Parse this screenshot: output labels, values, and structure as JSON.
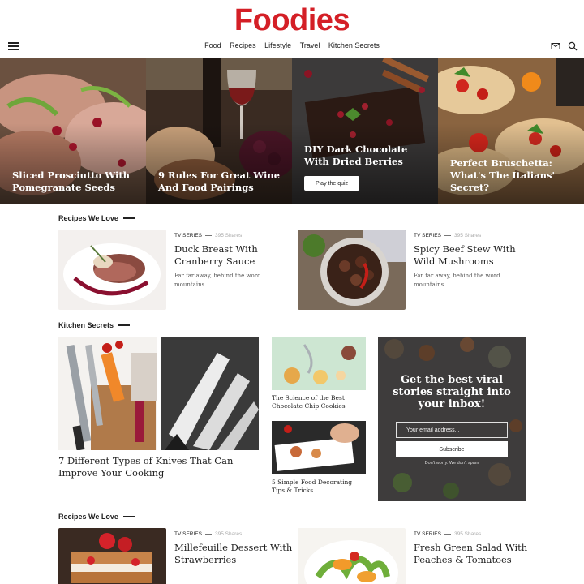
{
  "header": {
    "logo": "Foodies",
    "nav": [
      "Food",
      "Recipes",
      "Lifestyle",
      "Travel",
      "Kitchen Secrets"
    ],
    "icons": [
      "hamburger-menu-icon",
      "mail-icon",
      "search-icon"
    ]
  },
  "hero": [
    {
      "title": "Sliced Prosciutto With Pomegranate Seeds"
    },
    {
      "title": "9 Rules For Great Wine And Food Pairings"
    },
    {
      "title": "DIY Dark Chocolate With Dried Berries",
      "button": "Play the quiz"
    },
    {
      "title": "Perfect Bruschetta: What's The Italians' Secret?"
    }
  ],
  "recipes_love_1": {
    "label": "Recipes We Love",
    "cards": [
      {
        "category": "TV SERIES",
        "shares": "395 Shares",
        "title": "Duck Breast With Cranberry Sauce",
        "desc": "Far far away, behind the word mountains"
      },
      {
        "category": "TV SERIES",
        "shares": "395 Shares",
        "title": "Spicy Beef Stew With Wild Mushrooms",
        "desc": "Far far away, behind the word mountains"
      }
    ]
  },
  "kitchen_secrets": {
    "label": "Kitchen Secrets",
    "main_title": "7 Different Types of Knives That Can Improve Your Cooking",
    "small": [
      {
        "title": "The Science of the Best Chocolate Chip Cookies"
      },
      {
        "title": "5 Simple Food Decorating Tips & Tricks"
      }
    ],
    "newsletter": {
      "title": "Get the best viral stories straight into your inbox!",
      "placeholder": "Your email address...",
      "button": "Subscribe",
      "note": "Don't worry. We don't spam"
    }
  },
  "recipes_love_2": {
    "label": "Recipes We Love",
    "cards": [
      {
        "category": "TV SERIES",
        "shares": "395 Shares",
        "title": "Millefeuille Dessert With Strawberries"
      },
      {
        "category": "TV SERIES",
        "shares": "395 Shares",
        "title": "Fresh Green Salad With Peaches & Tomatoes"
      }
    ]
  },
  "colors": {
    "brand": "#d41f26",
    "text": "#222222"
  }
}
